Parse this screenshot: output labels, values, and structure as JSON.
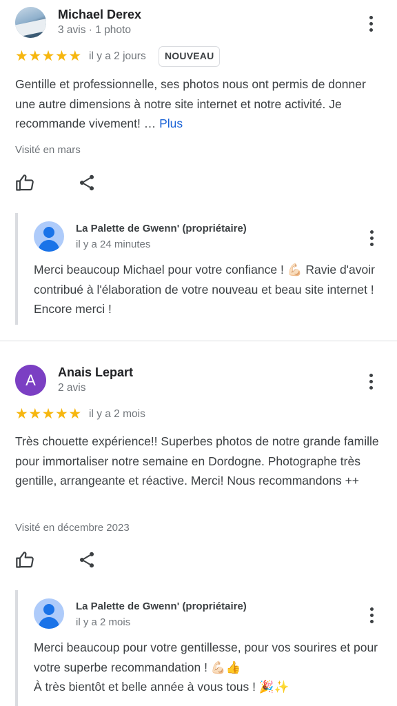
{
  "reviews": [
    {
      "author": "Michael Derex",
      "author_meta": "3 avis · 1 photo",
      "avatar_type": "photo",
      "rating": 5,
      "time": "il y a 2 jours",
      "badge": "NOUVEAU",
      "text": "Gentille et professionnelle, ses photos nous ont permis de donner une autre dimensions à notre site internet et notre activité. Je recommande vivement! …",
      "more_label": "Plus",
      "visited": "Visité en mars",
      "actions": [
        "thumbs-up-icon",
        "share-icon"
      ],
      "reply": {
        "owner": "La Palette de Gwenn' (propriétaire)",
        "time": "il y a 24 minutes",
        "text": "Merci beaucoup Michael pour votre confiance ! 💪🏻 Ravie d'avoir contribué à l'élaboration de votre nouveau et beau site internet ! Encore merci !"
      }
    },
    {
      "author": "Anais Lepart",
      "author_initial": "A",
      "author_meta": "2 avis",
      "avatar_type": "letter",
      "avatar_color": "#7b3fc3",
      "rating": 5,
      "time": "il y a 2 mois",
      "text": "Très chouette expérience!! Superbes photos de notre grande famille pour immortaliser notre semaine en Dordogne. Photographe très gentille, arrangeante et réactive. Merci! Nous recommandons ++",
      "visited": "Visité en décembre 2023",
      "actions": [
        "thumbs-up-icon",
        "share-icon"
      ],
      "reply": {
        "owner": "La Palette de Gwenn' (propriétaire)",
        "time": "il y a 2 mois",
        "text_line1": "Merci beaucoup pour votre gentillesse, pour vos sourires et pour votre superbe recommandation ! 💪🏻👍",
        "text_line2": "À très bientôt et belle année à vous tous ! 🎉✨"
      }
    }
  ],
  "colors": {
    "star": "#f6b60f",
    "link": "#1a62d6",
    "owner_avatar": "#1a73e8"
  }
}
